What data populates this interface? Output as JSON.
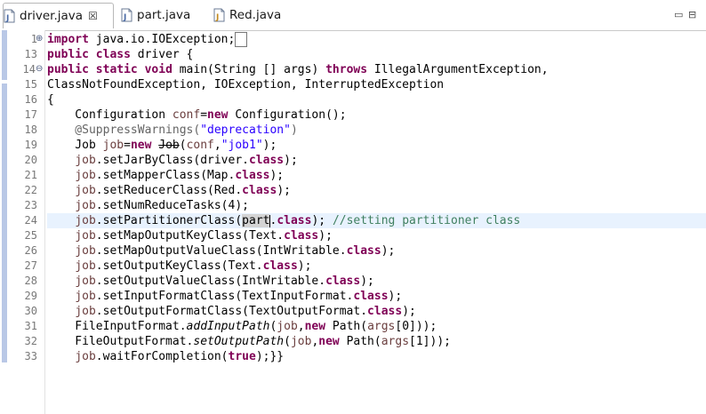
{
  "tabs": [
    {
      "label": "driver.java",
      "active": true,
      "close": "☒"
    },
    {
      "label": "part.java",
      "active": false
    },
    {
      "label": "Red.java",
      "active": false
    }
  ],
  "window": {
    "minimize": "▭",
    "maximize": "⊟"
  },
  "gutter": {
    "line_numbers": [
      "1",
      "13",
      "14",
      "15",
      "16",
      "17",
      "18",
      "19",
      "20",
      "21",
      "22",
      "23",
      "24",
      "25",
      "26",
      "27",
      "28",
      "29",
      "30",
      "31",
      "32",
      "33"
    ]
  },
  "code": {
    "l1": {
      "kw": "import",
      "rest": " java.io.IOException;"
    },
    "l13": {
      "kw1": "public",
      "kw2": "class",
      "rest": " driver {"
    },
    "l14": {
      "kw1": "public",
      "kw2": "static",
      "kw3": "void",
      "a": " main(String [] args) ",
      "kw4": "throws",
      "b": " IllegalArgumentException,"
    },
    "l15": {
      "text": "ClassNotFoundException, IOException, InterruptedException"
    },
    "l16": {
      "text": "{"
    },
    "l17": {
      "a": "    Configuration ",
      "fld": "conf",
      "b": "=",
      "kw": "new",
      "c": " Configuration();"
    },
    "l18": {
      "ann": "    @SuppressWarnings(",
      "str": "\"deprecation\"",
      "ann2": ")"
    },
    "l19": {
      "a": "    Job ",
      "fld": "job",
      "b": "=",
      "kw": "new",
      "c": " ",
      "strike": "Job",
      "d": "(",
      "fld2": "conf",
      "e": ",",
      "str": "\"job1\"",
      "f": ");"
    },
    "l20": {
      "fld": "job",
      "a": ".setJarByClass(driver.",
      "kw": "class",
      "b": ");"
    },
    "l21": {
      "fld": "job",
      "a": ".setMapperClass(Map.",
      "kw": "class",
      "b": ");"
    },
    "l22": {
      "fld": "job",
      "a": ".setReducerClass(Red.",
      "kw": "class",
      "b": ");"
    },
    "l23": {
      "fld": "job",
      "a": ".setNumReduceTasks(4);"
    },
    "l24": {
      "fld": "job",
      "a": ".setPartitionerClass(",
      "hl": "part",
      "b": ".",
      "kw": "class",
      "c": "); ",
      "cmt": "//setting partitioner class"
    },
    "l25": {
      "fld": "job",
      "a": ".setMapOutputKeyClass(Text.",
      "kw": "class",
      "b": ");"
    },
    "l26": {
      "fld": "job",
      "a": ".setMapOutputValueClass(IntWritable.",
      "kw": "class",
      "b": ");"
    },
    "l27": {
      "fld": "job",
      "a": ".setOutputKeyClass(Text.",
      "kw": "class",
      "b": ");"
    },
    "l28": {
      "fld": "job",
      "a": ".setOutputValueClass(IntWritable.",
      "kw": "class",
      "b": ");"
    },
    "l29": {
      "fld": "job",
      "a": ".setInputFormatClass(TextInputFormat.",
      "kw": "class",
      "b": ");"
    },
    "l30": {
      "fld": "job",
      "a": ".setOutputFormatClass(TextOutputFormat.",
      "kw": "class",
      "b": ");"
    },
    "l31": {
      "a": "    FileInputFormat.",
      "ital": "addInputPath",
      "b": "(",
      "fld": "job",
      "c": ",",
      "kw": "new",
      "d": " Path(",
      "fld2": "args",
      "e": "[0]));"
    },
    "l32": {
      "a": "    FileOutputFormat.",
      "ital": "setOutputPath",
      "b": "(",
      "fld": "job",
      "c": ",",
      "kw": "new",
      "d": " Path(",
      "fld2": "args",
      "e": "[1]));"
    },
    "l33": {
      "fld": "job",
      "a": ".waitForCompletion(",
      "kw": "true",
      "b": ");}}"
    }
  },
  "colors": {
    "keyword": "#7f0055",
    "field": "#6a3e3e",
    "string": "#2a00ff",
    "comment": "#3f7f5f",
    "annotation": "#646464",
    "current_line": "#e8f2fe"
  }
}
